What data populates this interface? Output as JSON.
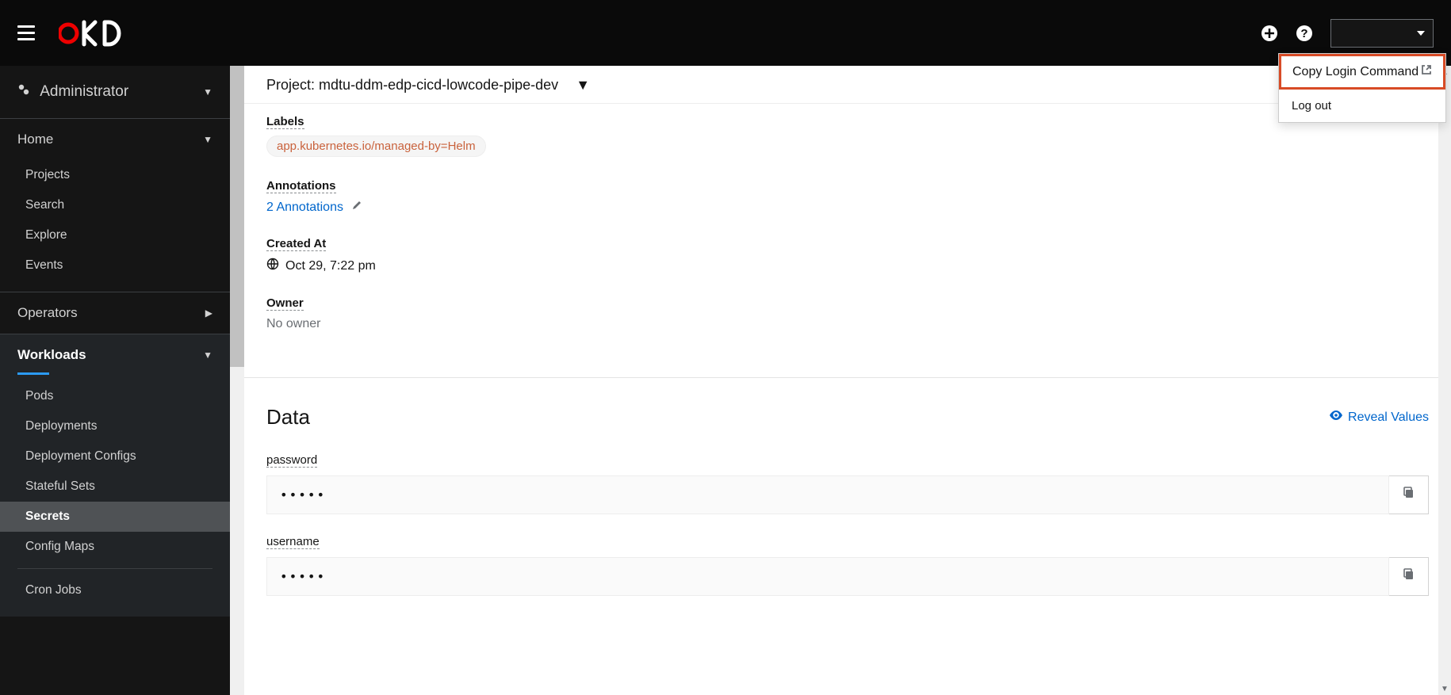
{
  "topbar": {
    "logo_text": "okd"
  },
  "user_menu": {
    "copy_login": "Copy Login Command",
    "logout": "Log out"
  },
  "sidebar": {
    "role": "Administrator",
    "sections": {
      "home": {
        "label": "Home",
        "items": [
          "Projects",
          "Search",
          "Explore",
          "Events"
        ]
      },
      "operators": {
        "label": "Operators"
      },
      "workloads": {
        "label": "Workloads",
        "items": [
          "Pods",
          "Deployments",
          "Deployment Configs",
          "Stateful Sets",
          "Secrets",
          "Config Maps",
          "Cron Jobs"
        ]
      }
    }
  },
  "project": {
    "prefix": "Project:",
    "name": "mdtu-ddm-edp-cicd-lowcode-pipe-dev"
  },
  "details": {
    "labels_title": "Labels",
    "label_chip": "app.kubernetes.io/managed-by=Helm",
    "annotations_title": "Annotations",
    "annotations_link": "2 Annotations",
    "created_title": "Created At",
    "created_value": "Oct 29, 7:22 pm",
    "owner_title": "Owner",
    "owner_value": "No owner"
  },
  "data_section": {
    "title": "Data",
    "reveal": "Reveal Values",
    "fields": {
      "password": {
        "label": "password",
        "masked": "•••••"
      },
      "username": {
        "label": "username",
        "masked": "•••••"
      }
    }
  }
}
